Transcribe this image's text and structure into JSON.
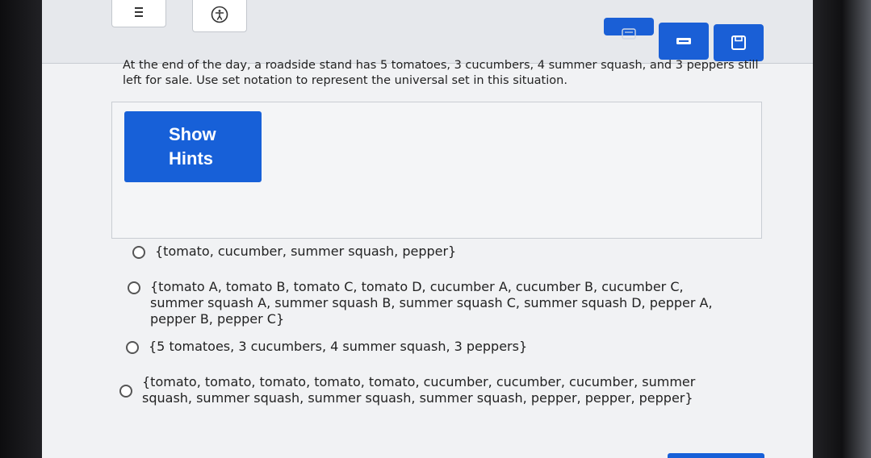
{
  "toolbar": {
    "menu_icon": "hamburger-icon",
    "accessibility_icon": "accessibility-icon",
    "calculator_icon": "calculator-icon",
    "minimize_icon": "minus-icon",
    "save_icon": "save-icon"
  },
  "question": {
    "text": "At the end of the day, a roadside stand has 5 tomatoes, 3 cucumbers, 4 summer squash, and 3 peppers still left for sale. Use set notation to represent the universal set in this situation."
  },
  "hints": {
    "button_line1": "Show",
    "button_line2": "Hints"
  },
  "options": [
    {
      "text": "{tomato, cucumber, summer squash, pepper}"
    },
    {
      "text": "{tomato A, tomato B, tomato C, tomato D, cucumber A, cucumber B, cucumber C, summer squash A, summer squash B, summer squash C, summer squash D, pepper A, pepper B, pepper C}"
    },
    {
      "text": "{5 tomatoes, 3 cucumbers, 4 summer squash, 3 peppers}"
    },
    {
      "text": "{tomato, tomato, tomato, tomato, tomato, cucumber, cucumber, cucumber, summer squash, summer squash, summer squash, summer squash, pepper, pepper, pepper}"
    }
  ],
  "colors": {
    "accent": "#1760d8",
    "background": "#f1f2f4",
    "text": "#222222"
  }
}
